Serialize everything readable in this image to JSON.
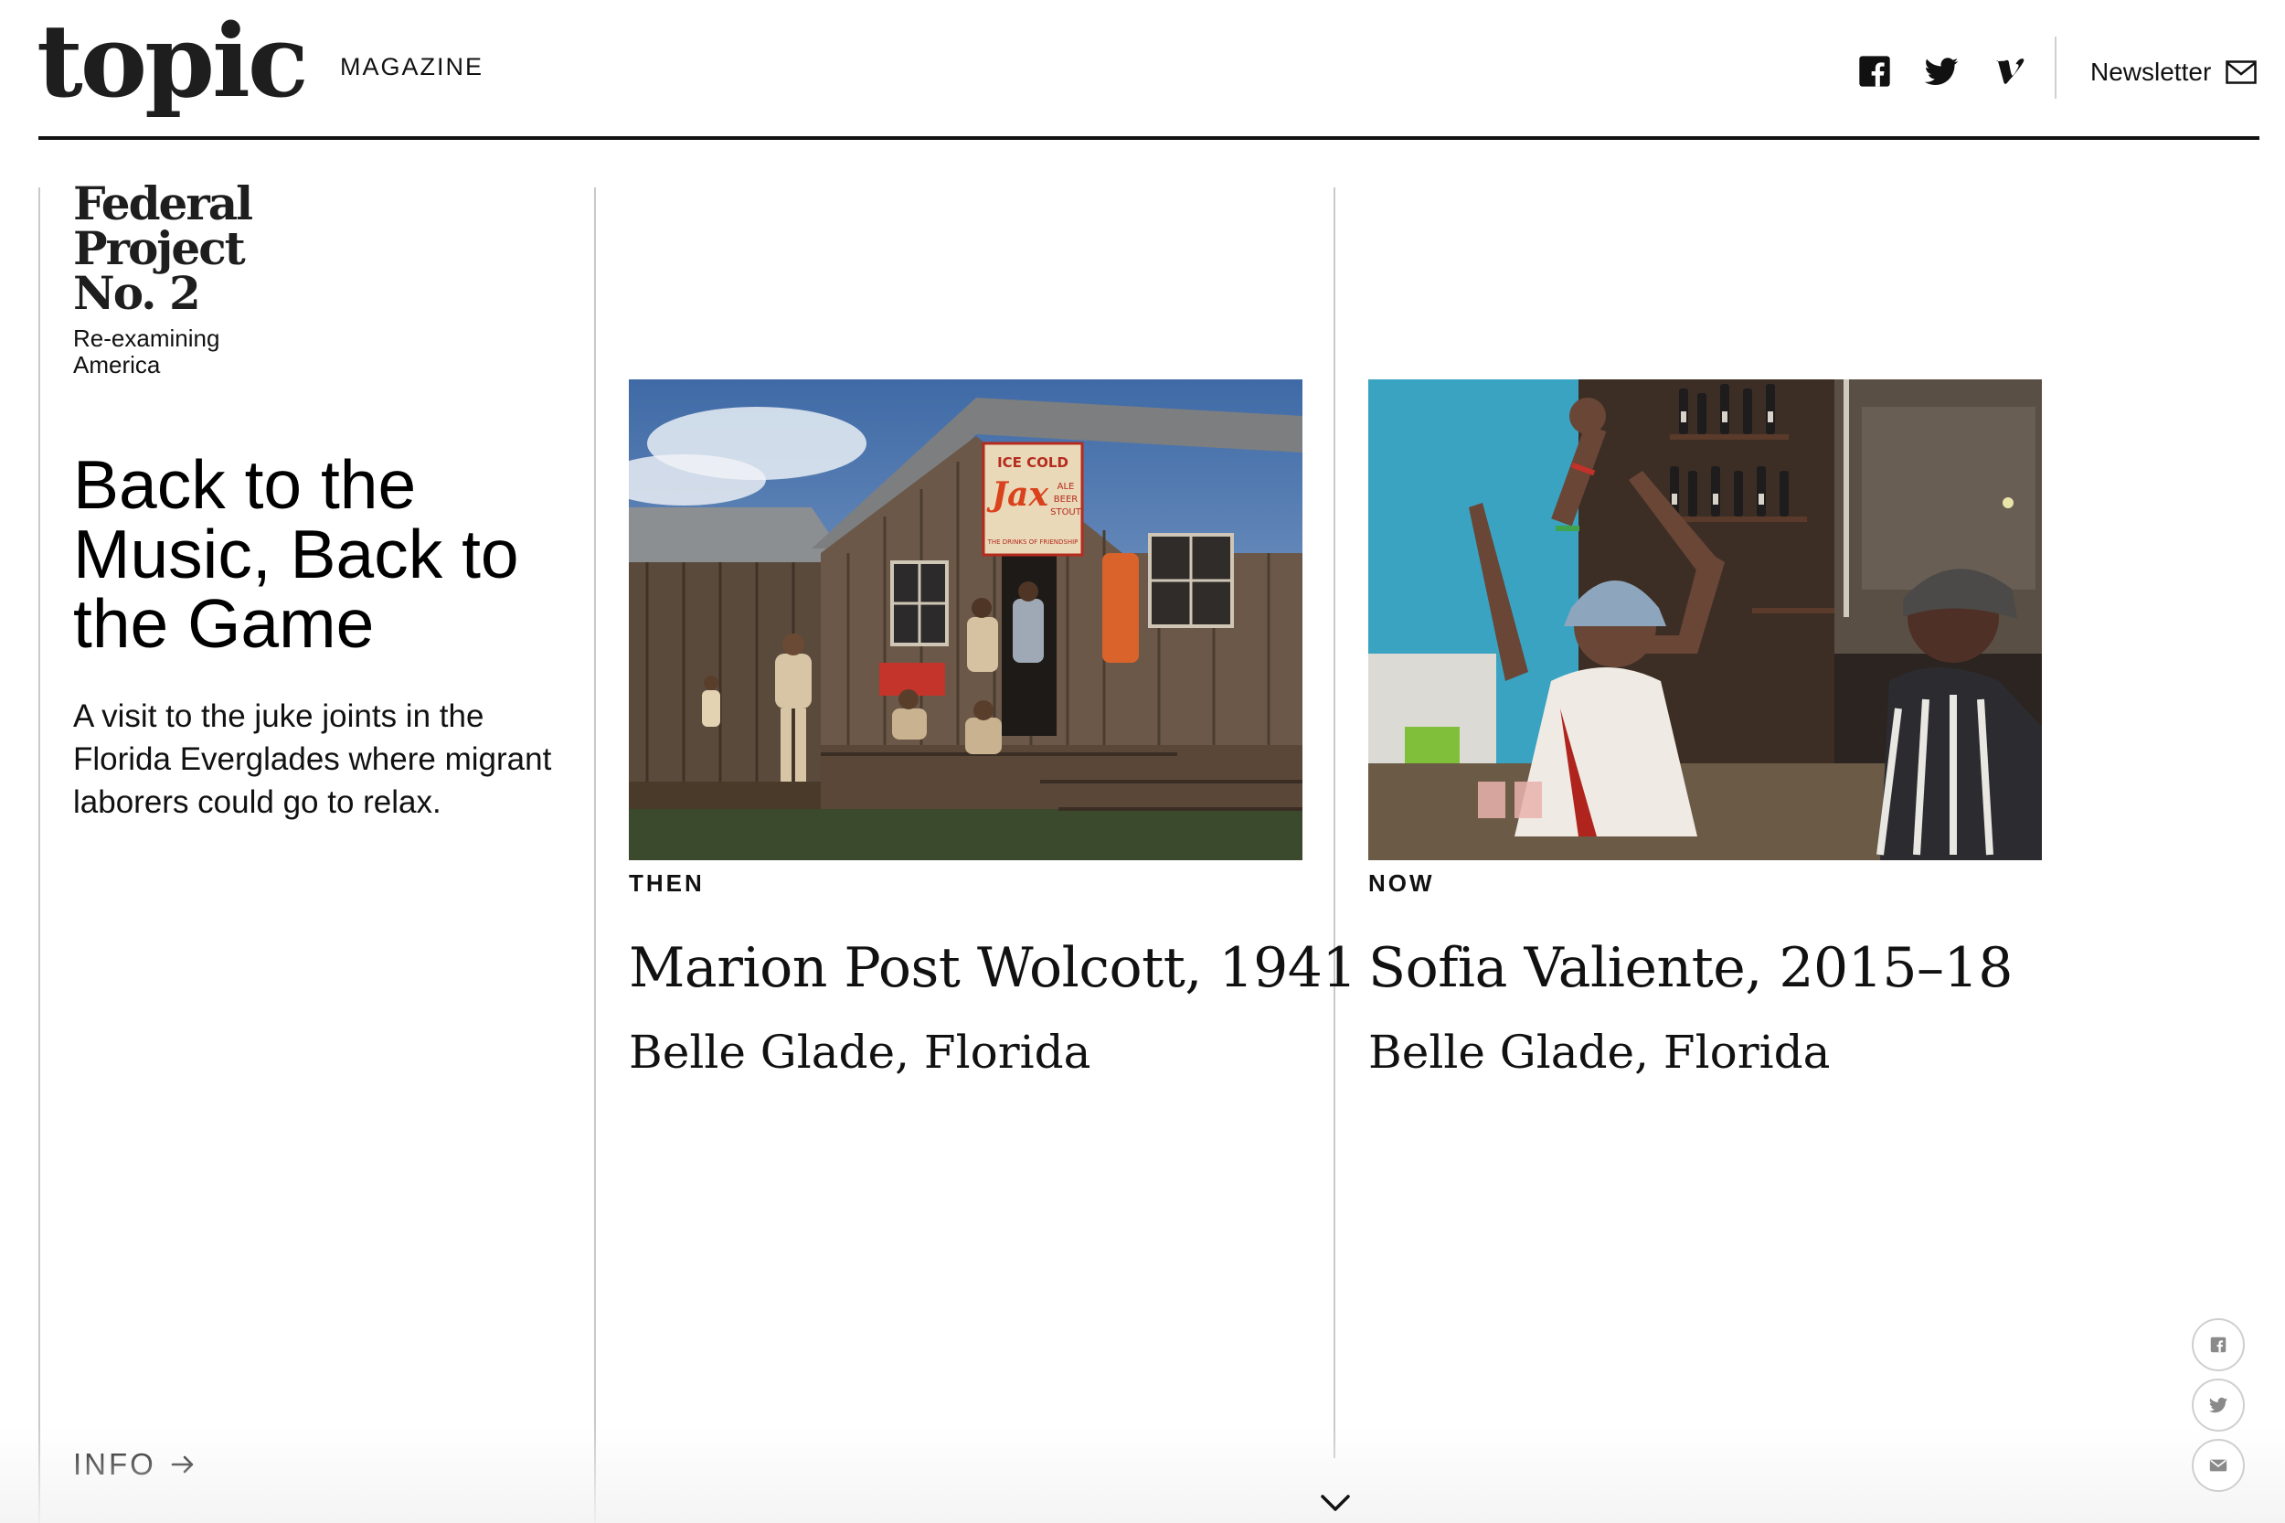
{
  "header": {
    "logo": "topic",
    "nav_magazine": "MAGAZINE",
    "social_icons": [
      "facebook-icon",
      "twitter-icon",
      "vimeo-icon"
    ],
    "newsletter_label": "Newsletter",
    "newsletter_icon": "mail-icon"
  },
  "sidebar": {
    "project_title_lines": [
      "Federal",
      "Project",
      "No. 2"
    ],
    "project_subtitle_lines": [
      "Re-examining",
      "America"
    ],
    "story_title": "Back to the Music, Back to the Game",
    "story_dek": "A visit to the juke joints in the Florida Everglades where migrant laborers could go to relax.",
    "info_label": "INFO",
    "info_icon": "arrow-right-icon"
  },
  "columns": [
    {
      "era": "THEN",
      "photographer": "Marion Post Wolcott, 1941",
      "location": "Belle Glade, Florida",
      "sign_text": [
        "ICE COLD",
        "Jax",
        "ALE",
        "BEER",
        "STOUT",
        "THE DRINKS OF FRIENDSHIP"
      ]
    },
    {
      "era": "NOW",
      "photographer": "Sofia Valiente, 2015–18",
      "location": "Belle Glade, Florida"
    }
  ],
  "share_buttons": [
    "facebook-icon",
    "twitter-icon",
    "email-icon"
  ],
  "scroll_icon": "chevron-down-icon",
  "colors": {
    "text": "#111111",
    "rule": "#111111",
    "divider": "#c9c9c9",
    "background": "#ffffff"
  }
}
